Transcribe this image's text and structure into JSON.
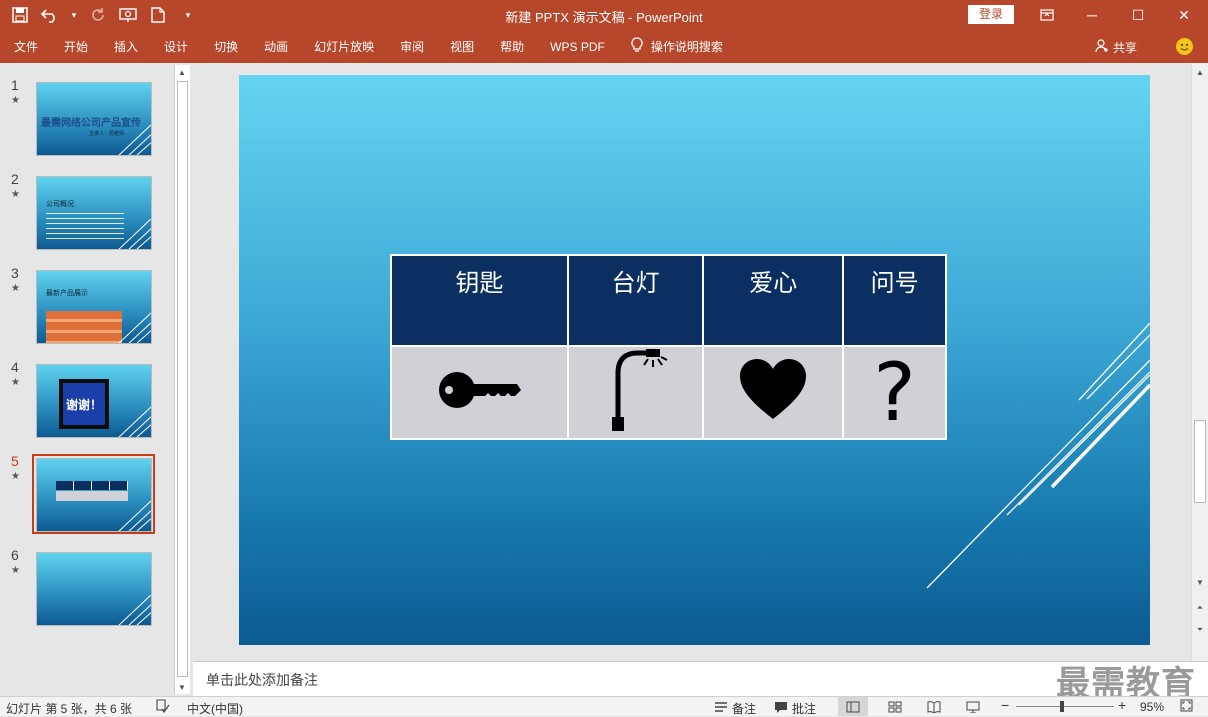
{
  "window": {
    "title": "新建 PPTX 演示文稿  -  PowerPoint",
    "login_label": "登录",
    "restore_icon": "ribbon-display-icon",
    "minimize_glyph": "─",
    "maximize_glyph": "☐",
    "close_glyph": "✕",
    "qat_more_glyph": "▾",
    "accent_color": "#b7472a"
  },
  "ribbon": {
    "tabs": [
      "文件",
      "开始",
      "插入",
      "设计",
      "切换",
      "动画",
      "幻灯片放映",
      "审阅",
      "视图",
      "帮助",
      "WPS PDF"
    ],
    "search_label": "操作说明搜索",
    "share_label": "共享"
  },
  "thumbnails": [
    {
      "num": "1",
      "star": "★",
      "title": "最需网络公司产品宣传",
      "subtitle": "主讲人：周老师"
    },
    {
      "num": "2",
      "star": "★",
      "title": "公司概况"
    },
    {
      "num": "3",
      "star": "★",
      "title": "最新产品展示"
    },
    {
      "num": "4",
      "star": "★",
      "title": "谢谢！"
    },
    {
      "num": "5",
      "star": "★",
      "selected": true
    },
    {
      "num": "6",
      "star": "★"
    }
  ],
  "slide": {
    "headers": [
      "钥匙",
      "台灯",
      "爱心",
      "问号"
    ],
    "icons": [
      "key-icon",
      "street-lamp-icon",
      "heart-icon",
      "question-mark-icon"
    ],
    "question_glyph": "?",
    "header_color": "#0a2f60",
    "cell_color": "#cfd1d6"
  },
  "notes": {
    "placeholder": "单击此处添加备注"
  },
  "watermark": "最需教育",
  "status": {
    "slide_info": "幻灯片 第 5 张，共 6 张",
    "language": "中文(中国)",
    "notes_label": "备注",
    "comments_label": "批注",
    "zoom": "95%",
    "zoom_level": 0.95
  }
}
